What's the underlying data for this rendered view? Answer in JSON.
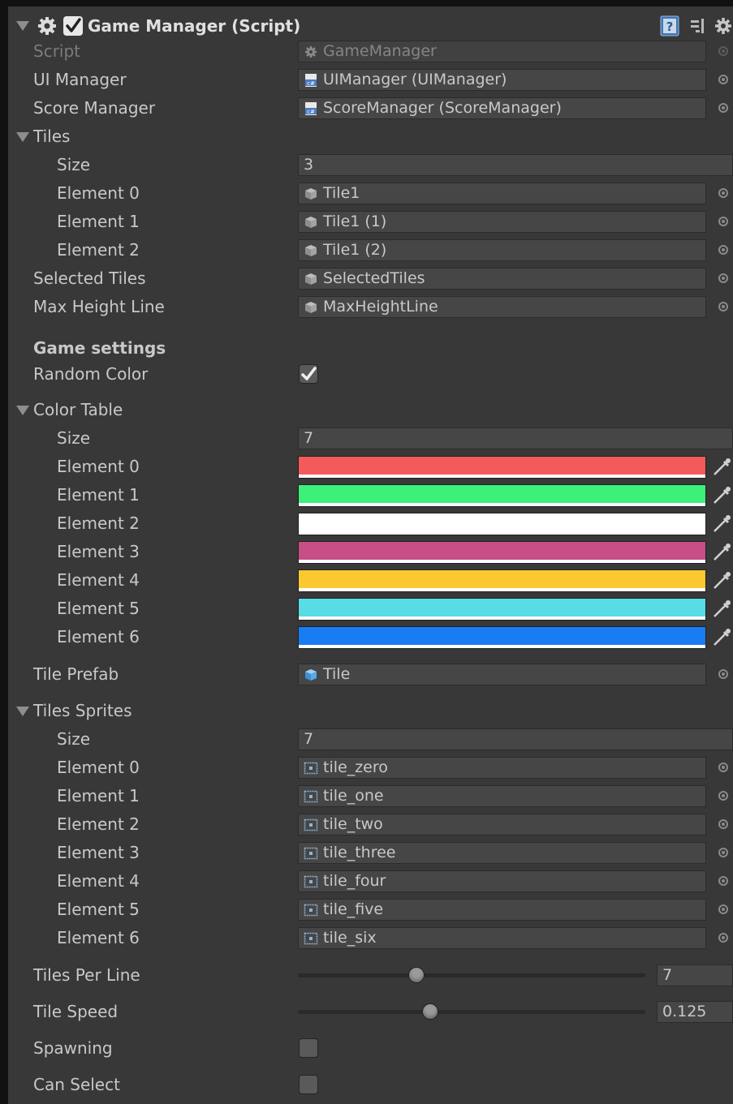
{
  "component": {
    "title": "Game Manager (Script)",
    "enabled": true,
    "icons": [
      "help-icon",
      "preset-icon",
      "gear-icon"
    ]
  },
  "fields": {
    "script": {
      "label": "Script",
      "value": "GameManager"
    },
    "ui_manager": {
      "label": "UI Manager",
      "value": "UIManager (UIManager)"
    },
    "score_manager": {
      "label": "Score Manager",
      "value": "ScoreManager (ScoreManager)"
    },
    "tiles": {
      "label": "Tiles",
      "size_label": "Size",
      "size": "3",
      "elements": [
        {
          "label": "Element 0",
          "value": "Tile1"
        },
        {
          "label": "Element 1",
          "value": "Tile1 (1)"
        },
        {
          "label": "Element 2",
          "value": "Tile1 (2)"
        }
      ]
    },
    "selected_tiles": {
      "label": "Selected Tiles",
      "value": "SelectedTiles"
    },
    "max_height_line": {
      "label": "Max Height Line",
      "value": "MaxHeightLine"
    },
    "game_settings_header": "Game settings",
    "random_color": {
      "label": "Random Color",
      "checked": true
    },
    "color_table": {
      "label": "Color Table",
      "size_label": "Size",
      "size": "7",
      "elements": [
        {
          "label": "Element 0",
          "color": "#f55a5a"
        },
        {
          "label": "Element 1",
          "color": "#3cf07a"
        },
        {
          "label": "Element 2",
          "color": "#ffffff"
        },
        {
          "label": "Element 3",
          "color": "#c74e87"
        },
        {
          "label": "Element 4",
          "color": "#fcc830"
        },
        {
          "label": "Element 5",
          "color": "#58dce6"
        },
        {
          "label": "Element 6",
          "color": "#1a7cf4"
        }
      ]
    },
    "tile_prefab": {
      "label": "Tile Prefab",
      "value": "Tile"
    },
    "tiles_sprites": {
      "label": "Tiles Sprites",
      "size_label": "Size",
      "size": "7",
      "elements": [
        {
          "label": "Element 0",
          "value": "tile_zero"
        },
        {
          "label": "Element 1",
          "value": "tile_one"
        },
        {
          "label": "Element 2",
          "value": "tile_two"
        },
        {
          "label": "Element 3",
          "value": "tile_three"
        },
        {
          "label": "Element 4",
          "value": "tile_four"
        },
        {
          "label": "Element 5",
          "value": "tile_five"
        },
        {
          "label": "Element 6",
          "value": "tile_six"
        }
      ]
    },
    "tiles_per_line": {
      "label": "Tiles Per Line",
      "value": "7",
      "slider_fraction": 0.34
    },
    "tile_speed": {
      "label": "Tile Speed",
      "value": "0.125",
      "slider_fraction": 0.38
    },
    "spawning": {
      "label": "Spawning",
      "checked": false
    },
    "can_select": {
      "label": "Can Select",
      "checked": false
    }
  }
}
